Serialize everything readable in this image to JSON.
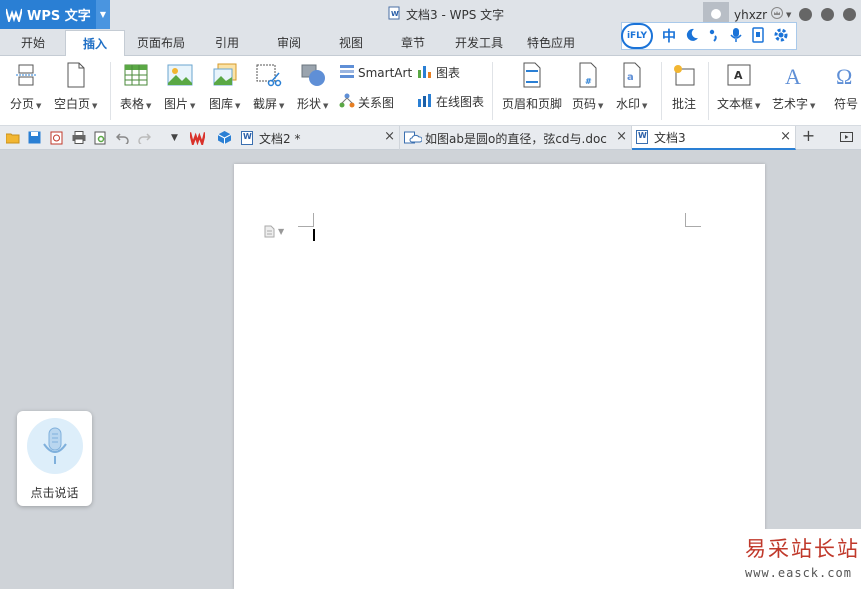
{
  "window": {
    "app_name": "WPS 文字",
    "doc_title": "文档3 - WPS 文字",
    "username": "yhxzr"
  },
  "ribbon_tabs": [
    {
      "label": "开始"
    },
    {
      "label": "插入"
    },
    {
      "label": "页面布局"
    },
    {
      "label": "引用"
    },
    {
      "label": "审阅"
    },
    {
      "label": "视图"
    },
    {
      "label": "章节"
    },
    {
      "label": "开发工具"
    },
    {
      "label": "特色应用"
    }
  ],
  "active_tab": "插入",
  "ifly_bar": {
    "logo": "iFLY",
    "lang": "中"
  },
  "toolbar": {
    "page_break": "分页",
    "blank_page": "空白页",
    "table": "表格",
    "picture": "图片",
    "gallery": "图库",
    "screenshot": "截屏",
    "shapes": "形状",
    "smartart": "SmartArt",
    "chart": "图表",
    "relation": "关系图",
    "online_chart": "在线图表",
    "header_footer": "页眉和页脚",
    "page_number": "页码",
    "watermark": "水印",
    "comment": "批注",
    "textbox": "文本框",
    "wordart": "艺术字",
    "symbol": "符号"
  },
  "doc_tabs": [
    {
      "label": "文档2 *",
      "active": false
    },
    {
      "label": "如图ab是圆o的直径，弦cd与.doc",
      "active": false
    },
    {
      "label": "文档3",
      "active": true
    }
  ],
  "voice_widget": {
    "label": "点击说话"
  },
  "site_watermark": {
    "title": "易采站长站",
    "url": "www.easck.com"
  },
  "colors": {
    "accent": "#2a7fd4",
    "ifly": "#1a73d8",
    "watermark_red": "#c0392b"
  }
}
